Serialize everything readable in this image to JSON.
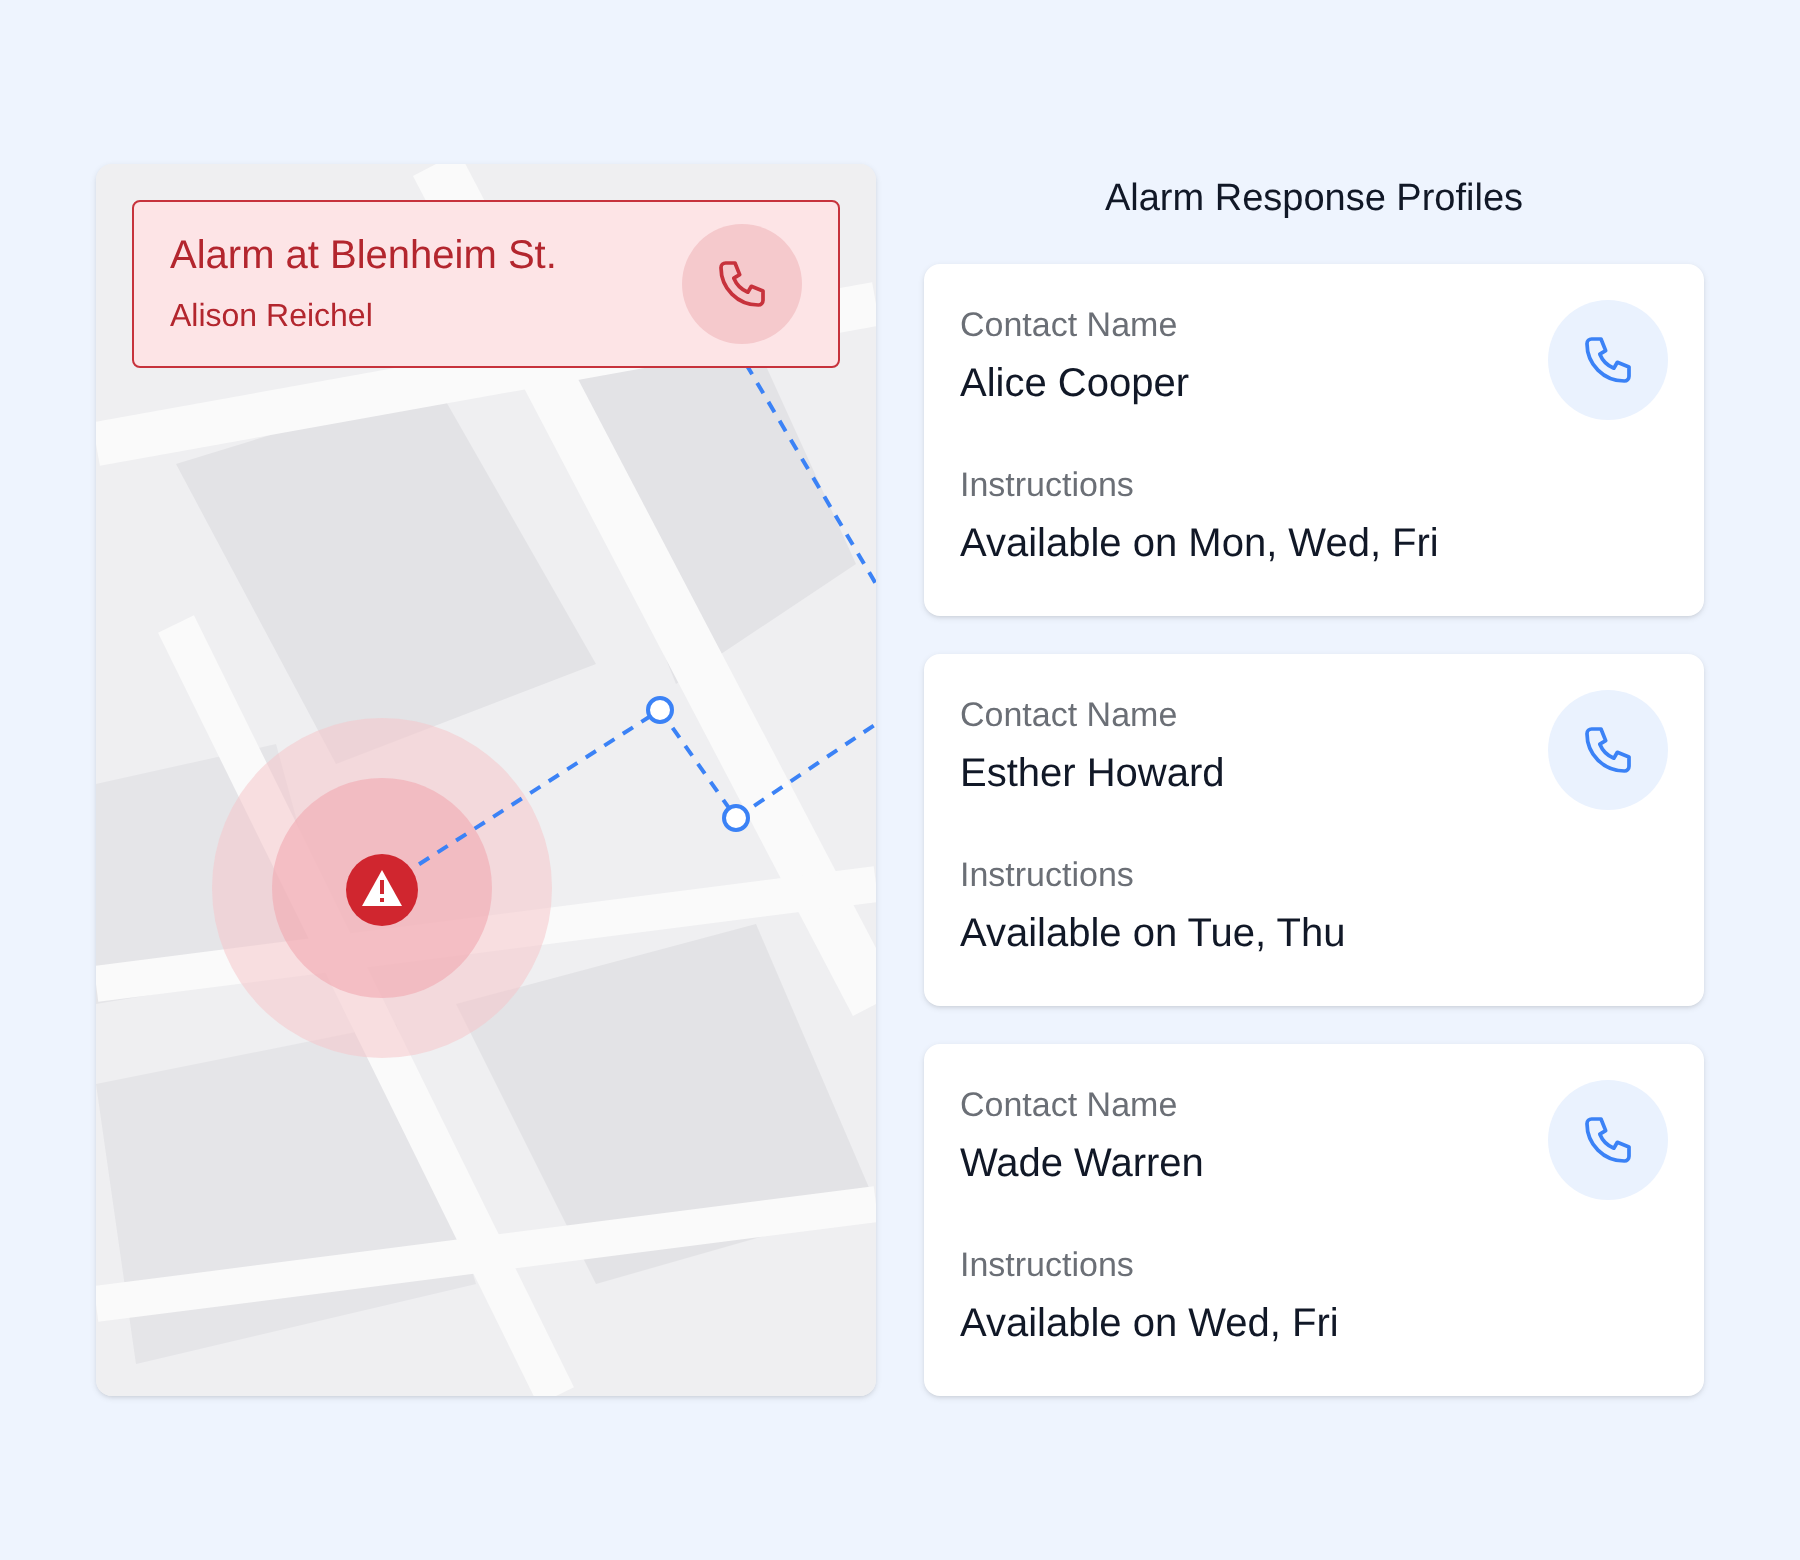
{
  "map": {
    "alert": {
      "title": "Alarm at Blenheim St.",
      "name": "Alison Reichel"
    }
  },
  "profiles_title": "Alarm Response Profiles",
  "profiles": [
    {
      "name_label": "Contact Name",
      "name": "Alice Cooper",
      "instructions_label": "Instructions",
      "instructions": "Available on Mon, Wed, Fri"
    },
    {
      "name_label": "Contact Name",
      "name": "Esther Howard",
      "instructions_label": "Instructions",
      "instructions": "Available on Tue, Thu"
    },
    {
      "name_label": "Contact Name",
      "name": "Wade Warren",
      "instructions_label": "Instructions",
      "instructions": "Available on Wed, Fri"
    }
  ]
}
